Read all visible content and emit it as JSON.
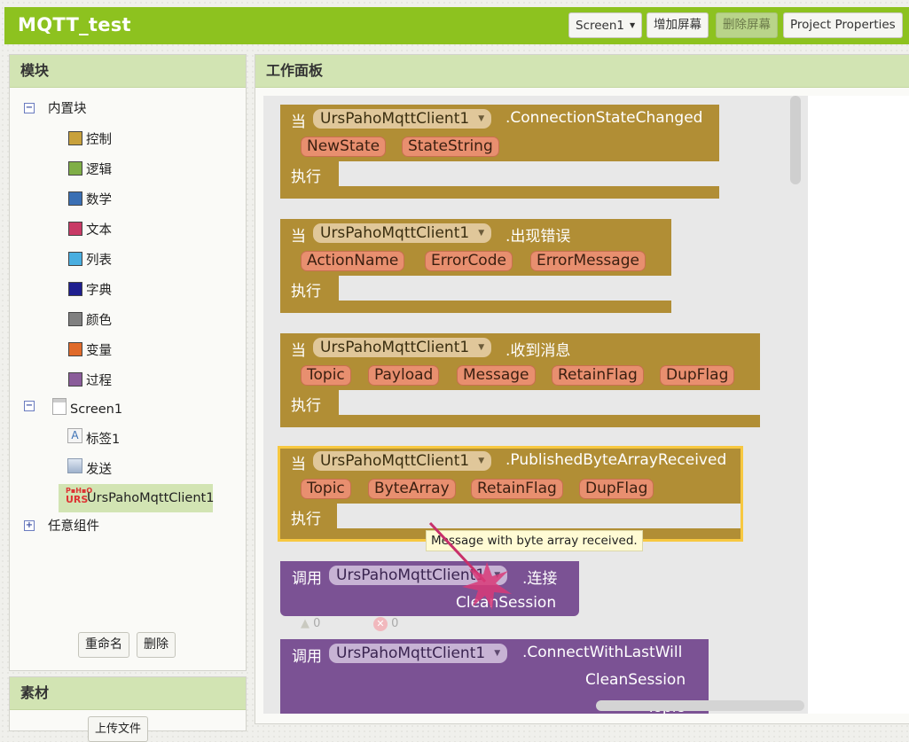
{
  "app": {
    "title": "MQTT_test"
  },
  "toolbar": {
    "screen_select": "Screen1",
    "add_screen": "增加屏幕",
    "remove_screen": "删除屏幕",
    "project_properties": "Project Properties"
  },
  "blocks_panel": {
    "title": "模块",
    "builtin_label": "内置块",
    "builtin_items": [
      {
        "label": "控制",
        "color": "#c8a13c"
      },
      {
        "label": "逻辑",
        "color": "#7fae47"
      },
      {
        "label": "数学",
        "color": "#3a6fb4"
      },
      {
        "label": "文本",
        "color": "#c83a66"
      },
      {
        "label": "列表",
        "color": "#49aee0"
      },
      {
        "label": "字典",
        "color": "#1f1f8f"
      },
      {
        "label": "颜色",
        "color": "#808080"
      },
      {
        "label": "变量",
        "color": "#e06a2a"
      },
      {
        "label": "过程",
        "color": "#8a5c9a"
      }
    ],
    "screen_label": "Screen1",
    "components": [
      {
        "label": "标签1",
        "icon": "label-icon"
      },
      {
        "label": "发送",
        "icon": "button-icon"
      },
      {
        "label": "UrsPahoMqttClient1",
        "icon": "mqtt-icon",
        "selected": true
      }
    ],
    "any_component_label": "任意组件",
    "rename_button": "重命名",
    "delete_button": "删除"
  },
  "media_panel": {
    "title": "素材",
    "upload_button": "上传文件"
  },
  "workspace": {
    "title": "工作面板",
    "tooltip": "Message with byte array received.",
    "warnings": {
      "warning_count": "0",
      "error_count": "0"
    },
    "blocks": [
      {
        "kind": "event",
        "when": "当",
        "component": "UrsPahoMqttClient1",
        "event": ".ConnectionStateChanged",
        "params": [
          "NewState",
          "StateString"
        ],
        "do": "执行"
      },
      {
        "kind": "event",
        "when": "当",
        "component": "UrsPahoMqttClient1",
        "event": ".出现错误",
        "params": [
          "ActionName",
          "ErrorCode",
          "ErrorMessage"
        ],
        "do": "执行"
      },
      {
        "kind": "event",
        "when": "当",
        "component": "UrsPahoMqttClient1",
        "event": ".收到消息",
        "params": [
          "Topic",
          "Payload",
          "Message",
          "RetainFlag",
          "DupFlag"
        ],
        "do": "执行"
      },
      {
        "kind": "event",
        "when": "当",
        "component": "UrsPahoMqttClient1",
        "event": ".PublishedByteArrayReceived",
        "params": [
          "Topic",
          "ByteArray",
          "RetainFlag",
          "DupFlag"
        ],
        "do": "执行",
        "highlighted": true
      },
      {
        "kind": "call",
        "call": "调用",
        "component": "UrsPahoMqttClient1",
        "method": ".连接",
        "args": [
          "CleanSession"
        ]
      },
      {
        "kind": "call",
        "call": "调用",
        "component": "UrsPahoMqttClient1",
        "method": ".ConnectWithLastWill",
        "args": [
          "CleanSession",
          "Topic"
        ]
      }
    ]
  }
}
